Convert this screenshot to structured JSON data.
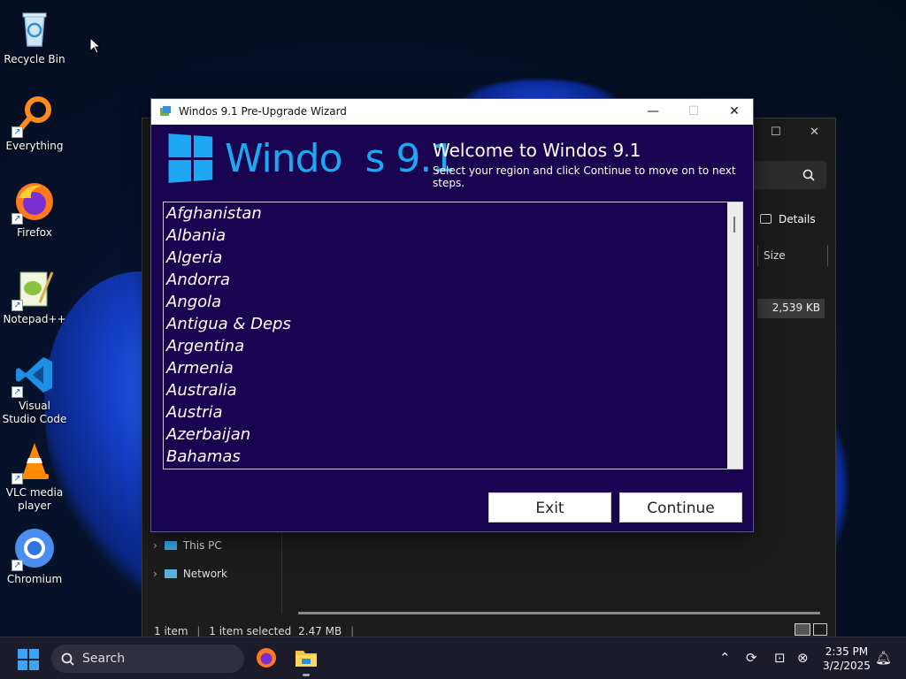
{
  "desktop": {
    "icons": [
      {
        "label": "Recycle Bin",
        "icon": "recycle-bin-icon"
      },
      {
        "label": "Everything",
        "icon": "everything-search-icon"
      },
      {
        "label": "Firefox",
        "icon": "firefox-icon"
      },
      {
        "label": "Notepad++",
        "icon": "notepadpp-icon"
      },
      {
        "label": "Visual Studio Code",
        "icon": "vscode-icon"
      },
      {
        "label": "VLC media player",
        "icon": "vlc-icon"
      },
      {
        "label": "Chromium",
        "icon": "chromium-icon"
      }
    ]
  },
  "explorer": {
    "view_label": "Details",
    "column_size": "Size",
    "file_size": "2,539 KB",
    "nav": [
      {
        "label": "This PC"
      },
      {
        "label": "Network"
      }
    ],
    "status": {
      "items": "1 item",
      "selected": "1 item selected",
      "size": "2.47 MB"
    }
  },
  "wizard": {
    "window_title": "Windos 9.1 Pre-Upgrade Wizard",
    "logo_text": "Windo  s 9.1",
    "welcome": "Welcome to Windos 9.1",
    "subtitle": "Select your region and click Continue to move on to next steps.",
    "regions": [
      "Afghanistan",
      "Albania",
      "Algeria",
      "Andorra",
      "Angola",
      "Antigua & Deps",
      "Argentina",
      "Armenia",
      "Australia",
      "Austria",
      "Azerbaijan",
      "Bahamas"
    ],
    "exit_label": "Exit",
    "continue_label": "Continue",
    "colors": {
      "background": "#180451",
      "logo": "#1ea7f2"
    }
  },
  "taskbar": {
    "search_placeholder": "Search",
    "time": "2:35 PM",
    "date": "3/2/2025"
  }
}
